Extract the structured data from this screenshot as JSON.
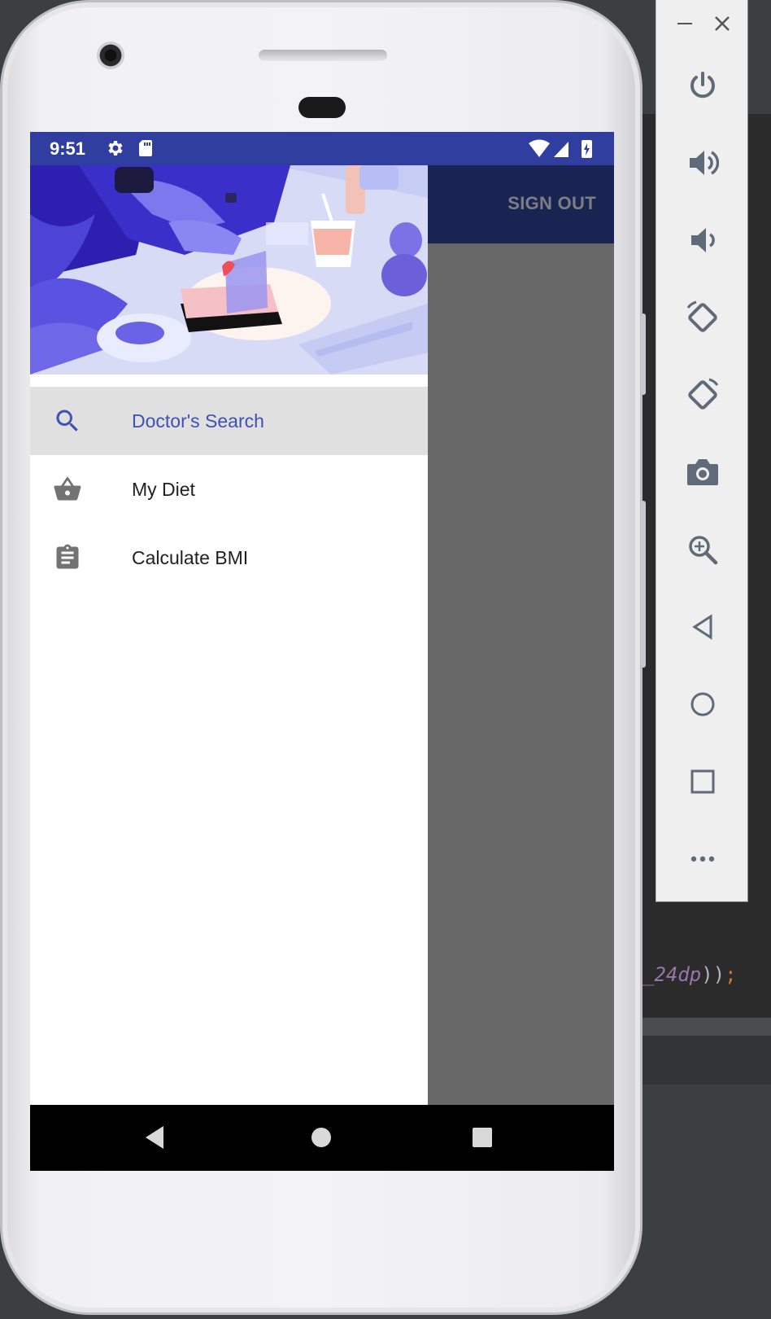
{
  "status_bar": {
    "time": "9:51",
    "icons": [
      "gear-icon",
      "sd-card-icon",
      "wifi-icon",
      "signal-icon",
      "battery-charging-icon"
    ]
  },
  "toolbar": {
    "sign_out_label": "SIGN OUT"
  },
  "drawer": {
    "header_image": "health-illustration",
    "items": [
      {
        "label": "Doctor's Search",
        "icon": "search-icon",
        "selected": true
      },
      {
        "label": "My Diet",
        "icon": "basket-icon",
        "selected": false
      },
      {
        "label": "Calculate BMI",
        "icon": "clipboard-icon",
        "selected": false
      }
    ]
  },
  "android_nav": {
    "buttons": [
      "back-icon",
      "home-icon",
      "recents-icon"
    ]
  },
  "emulator_panel": {
    "window_controls": [
      "minimize-icon",
      "close-icon"
    ],
    "buttons": [
      "power-icon",
      "volume-up-icon",
      "volume-down-icon",
      "rotate-left-icon",
      "rotate-right-icon",
      "camera-icon",
      "zoom-icon",
      "back-icon",
      "home-icon",
      "overview-icon",
      "more-icon"
    ]
  },
  "ide": {
    "code_comment": "_24dp",
    "code_punct": "))",
    "code_semicolon": ";"
  },
  "colors": {
    "primary": "#303f9f",
    "accent": "#3f51b5",
    "toolbar_dark": "#1a2452",
    "selected_bg": "#e0e0e0",
    "scrim": "#686868"
  }
}
